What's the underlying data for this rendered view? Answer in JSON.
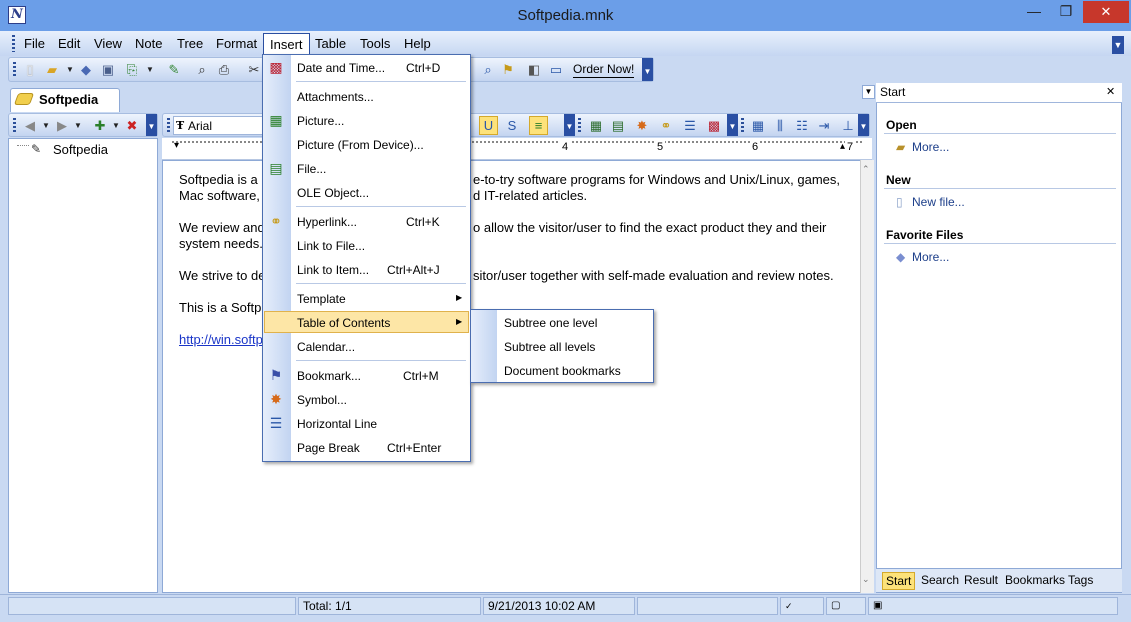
{
  "window": {
    "title": "Softpedia.mnk",
    "app_icon": "N",
    "min": "—",
    "max": "❐",
    "close": "✕"
  },
  "menubar": [
    "File",
    "Edit",
    "View",
    "Note",
    "Tree",
    "Format",
    "Insert",
    "Table",
    "Tools",
    "Help"
  ],
  "toolbar": {
    "order_now": "Order Now!",
    "font_name": "Arial"
  },
  "left_panel": {
    "tab": "Softpedia",
    "tree_root": "Softpedia"
  },
  "ruler": {
    "marks": [
      "4",
      "5",
      "6",
      "7"
    ]
  },
  "editor": {
    "p1a": "Softpedia is a",
    "p1b": "e-to-try software programs for Windows and Unix/Linux, games,",
    "p1c": "Mac software,",
    "p1d": "d IT-related articles.",
    "p2a": "We review and",
    "p2b": "o allow the visitor/user to find the exact product they and their",
    "p2c": "system needs.",
    "p3a": "We strive to de",
    "p3b": "sitor/user together with self-made evaluation and review notes.",
    "p4a": "This is a Softp",
    "link": "http://win.softp"
  },
  "insert_menu": [
    {
      "label": "Date and Time...",
      "shortcut": "Ctrl+D"
    },
    {
      "label": "Attachments...",
      "shortcut": ""
    },
    {
      "label": "Picture...",
      "shortcut": ""
    },
    {
      "label": "Picture (From Device)...",
      "shortcut": ""
    },
    {
      "label": "File...",
      "shortcut": ""
    },
    {
      "label": "OLE Object...",
      "shortcut": ""
    },
    {
      "label": "Hyperlink...",
      "shortcut": "Ctrl+K"
    },
    {
      "label": "Link to File...",
      "shortcut": ""
    },
    {
      "label": "Link to Item...",
      "shortcut": "Ctrl+Alt+J"
    },
    {
      "label": "Template",
      "shortcut": ""
    },
    {
      "label": "Table of Contents",
      "shortcut": ""
    },
    {
      "label": "Calendar...",
      "shortcut": ""
    },
    {
      "label": "Bookmark...",
      "shortcut": "Ctrl+M"
    },
    {
      "label": "Symbol...",
      "shortcut": ""
    },
    {
      "label": "Horizontal Line",
      "shortcut": ""
    },
    {
      "label": "Page Break",
      "shortcut": "Ctrl+Enter"
    }
  ],
  "toc_submenu": [
    "Subtree one level",
    "Subtree all levels",
    "Document bookmarks"
  ],
  "right_panel": {
    "header": "Start",
    "open_title": "Open",
    "open_link": "More...",
    "new_title": "New",
    "new_link": "New file...",
    "fav_title": "Favorite Files",
    "fav_link": "More...",
    "tabs": [
      "Start",
      "Search",
      "Result",
      "Bookmarks",
      "Tags"
    ]
  },
  "status": {
    "total": "Total: 1/1",
    "datetime": "9/21/2013 10:02 AM"
  }
}
